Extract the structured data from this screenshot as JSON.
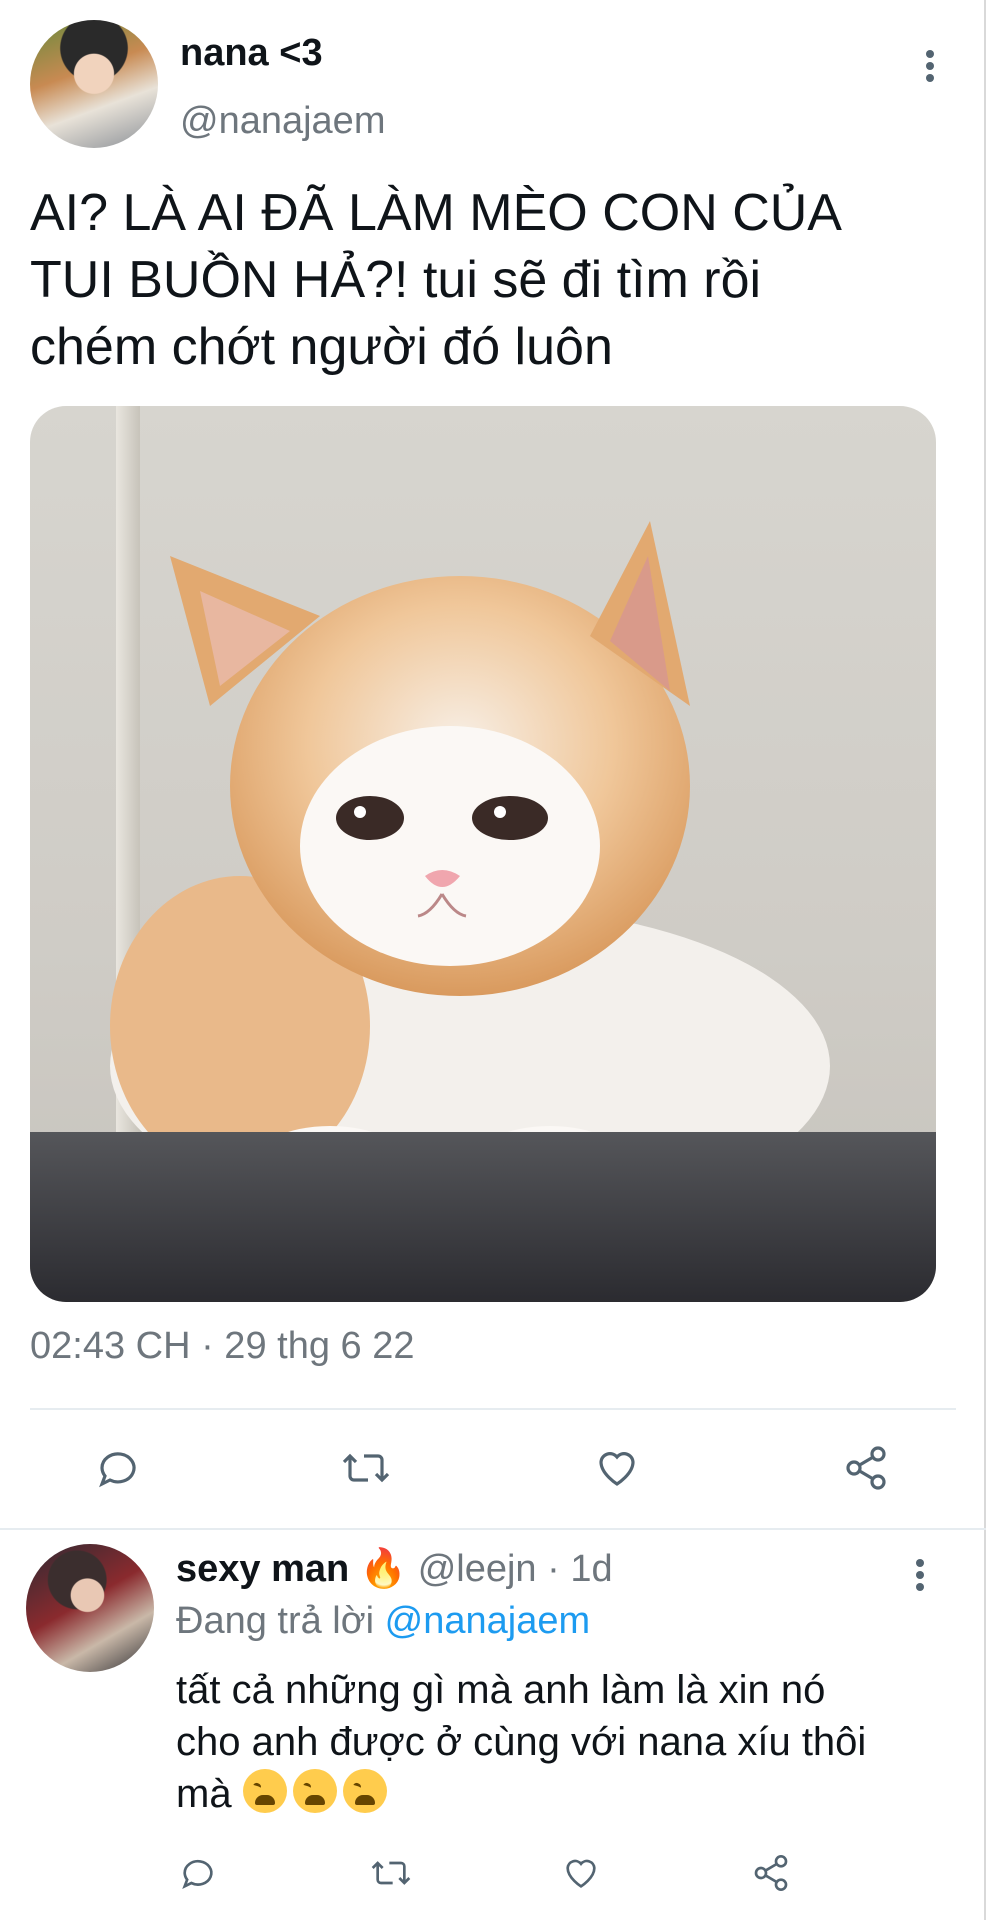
{
  "tweet": {
    "display_name": "nana <3",
    "handle": "@nanajaem",
    "text_lines": [
      "AI? LÀ AI ĐÃ LÀM MÈO CON CỦA",
      "TUI BUỒN HẢ?! tui sẽ đi tìm rồi",
      "chém chớt người đó luôn"
    ],
    "timestamp": "02:43 CH · 29 thg 6 22"
  },
  "icons": {
    "more": "more-vertical-icon",
    "reply": "reply-icon",
    "retweet": "retweet-icon",
    "like": "heart-icon",
    "share": "share-icon"
  },
  "reply": {
    "display_name": "sexy man",
    "emoji": "🔥",
    "handle_time": "@leejn · 1d",
    "replying_label": "Đang trả lời",
    "replying_to": "@nanajaem",
    "text_line1": "tất cả những gì mà anh làm là xin nó",
    "text_line2": "cho anh được ở cùng với nana xíu thôi",
    "text_line3": "mà"
  },
  "colors": {
    "text": "#0f1419",
    "muted": "#6e767d",
    "link": "#1d9bf0",
    "divider": "#e6ecf0"
  }
}
